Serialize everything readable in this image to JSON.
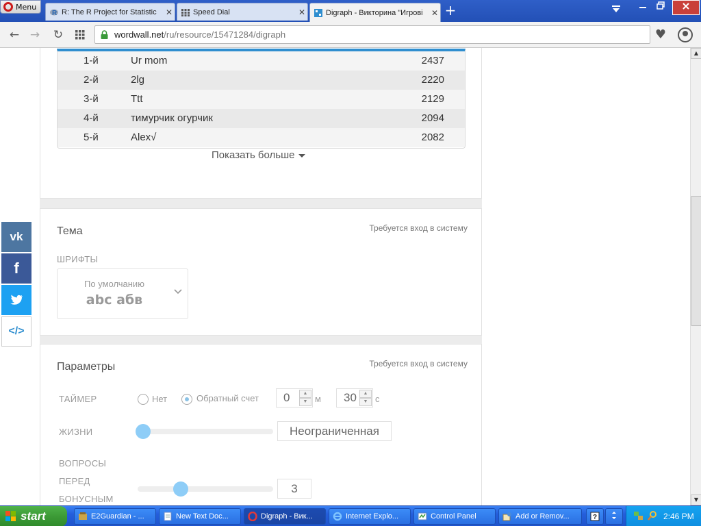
{
  "browser": {
    "menu_label": "Menu",
    "tabs": [
      {
        "label": "R: The R Project for Statistic",
        "icon": "r-project-icon"
      },
      {
        "label": "Speed Dial",
        "icon": "speed-dial-icon"
      },
      {
        "label": "Digraph - Викторина \"Игрові",
        "icon": "wordwall-icon",
        "active": true
      }
    ],
    "url_host": "wordwall.net",
    "url_path": "/ru/resource/15471284/digraph"
  },
  "leaderboard": {
    "rows": [
      {
        "rank": "1-й",
        "name": "Ur mom",
        "score": "2437"
      },
      {
        "rank": "2-й",
        "name": "2lg",
        "score": "2220"
      },
      {
        "rank": "3-й",
        "name": "Ttt",
        "score": "2129"
      },
      {
        "rank": "4-й",
        "name": "тимурчик огурчик",
        "score": "2094"
      },
      {
        "rank": "5-й",
        "name": "Alex√",
        "score": "2082"
      }
    ],
    "show_more": "Показать больше"
  },
  "theme": {
    "title": "Тема",
    "login_note": "Требуется вход в систему",
    "fonts_label": "ШРИФТЫ",
    "font_default": "По умолчанию",
    "font_sample": "abc абв"
  },
  "params": {
    "title": "Параметры",
    "login_note": "Требуется вход в систему",
    "timer_label": "ТАЙМЕР",
    "timer_none": "Нет",
    "timer_countdown": "Обратный счет",
    "minutes_value": "0",
    "minutes_unit": "м",
    "seconds_value": "30",
    "seconds_unit": "с",
    "lives_label": "ЖИЗНИ",
    "lives_value": "Неограниченная",
    "lives_slider": 0,
    "bonus_label_1": "ВОПРОСЫ",
    "bonus_label_2": "ПЕРЕД",
    "bonus_label_3": "БОНУСНЫМ",
    "bonus_value": "3",
    "bonus_slider": 0.3
  },
  "social": {
    "vk": "vk",
    "facebook": "f",
    "twitter": "t",
    "embed": "</>"
  },
  "taskbar": {
    "start_label": "start",
    "buttons": [
      {
        "label": "E2Guardian - ...",
        "icon": "e2guardian-icon"
      },
      {
        "label": "New Text Doc...",
        "icon": "notepad-icon"
      },
      {
        "label": "Digraph - Вик...",
        "icon": "opera-icon",
        "active": true
      },
      {
        "label": "Internet Explo...",
        "icon": "ie-icon"
      },
      {
        "label": "Control Panel",
        "icon": "control-panel-icon"
      },
      {
        "label": "Add or Remov...",
        "icon": "add-remove-icon"
      }
    ],
    "clock": "2:46 PM"
  },
  "colors": {
    "accent": "#2f8ecf",
    "slider_knob": "#8ecdf7",
    "taskbar_blue": "#245edb",
    "start_green": "#3c9a36"
  }
}
